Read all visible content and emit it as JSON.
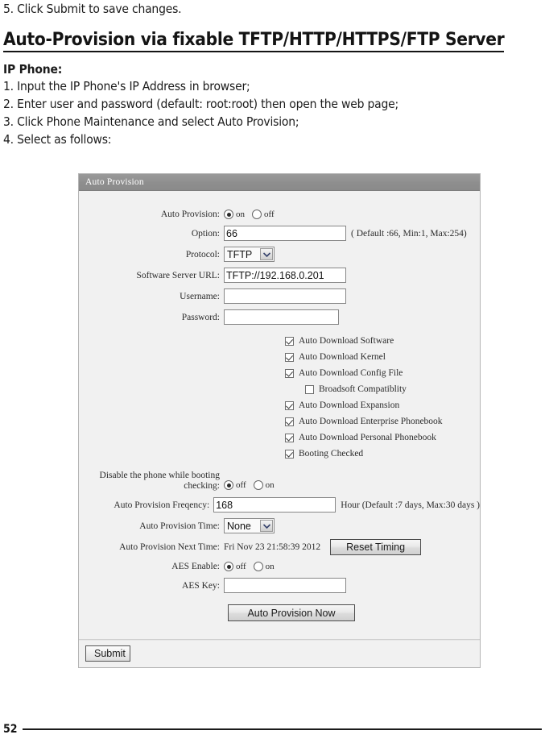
{
  "document": {
    "step_5": "5. Click Submit to save changes.",
    "section_title": "Auto-Provision via fixable TFTP/HTTP/HTTPS/FTP Server",
    "ip_phone_heading": "IP Phone:",
    "steps": [
      "1. Input the IP Phone's IP Address in browser;",
      "2. Enter user and password (default: root:root) then open the web page;",
      "3. Click Phone Maintenance and select Auto Provision;",
      "4. Select as follows:"
    ],
    "page_number": "52"
  },
  "panel": {
    "header_title": "Auto Provision",
    "fields": {
      "auto_provision": {
        "label": "Auto Provision:",
        "options": [
          "on",
          "off"
        ],
        "selected": "on"
      },
      "option": {
        "label": "Option:",
        "value": "66",
        "hint": "( Default :66, Min:1, Max:254)"
      },
      "protocol": {
        "label": "Protocol:",
        "value": "TFTP"
      },
      "software_server_url": {
        "label": "Software Server URL:",
        "value": "TFTP://192.168.0.201"
      },
      "username": {
        "label": "Username:",
        "value": ""
      },
      "password": {
        "label": "Password:",
        "value": ""
      },
      "disable_phone_booting": {
        "label_line1": "Disable the phone while booting",
        "label_line2": "checking:",
        "options": [
          "off",
          "on"
        ],
        "selected": "off"
      },
      "auto_provision_frequency": {
        "label": "Auto Provision Freqency:",
        "value": "168",
        "hint": "Hour (Default :7 days, Max:30 days )"
      },
      "auto_provision_time": {
        "label": "Auto Provision Time:",
        "value": "None"
      },
      "auto_provision_next_time": {
        "label": "Auto Provision Next Time:",
        "value": "Fri Nov 23 21:58:39 2012",
        "button": "Reset Timing"
      },
      "aes_enable": {
        "label": "AES Enable:",
        "options": [
          "off",
          "on"
        ],
        "selected": "off"
      },
      "aes_key": {
        "label": "AES Key:",
        "value": ""
      }
    },
    "checkboxes": [
      {
        "label": "Auto Download Software",
        "checked": true,
        "indent": false
      },
      {
        "label": "Auto Download Kernel",
        "checked": true,
        "indent": false
      },
      {
        "label": "Auto Download Config File",
        "checked": true,
        "indent": false
      },
      {
        "label": "Broadsoft Compatiblity",
        "checked": false,
        "indent": true
      },
      {
        "label": "Auto Download Expansion",
        "checked": true,
        "indent": false
      },
      {
        "label": "Auto Download Enterprise Phonebook",
        "checked": true,
        "indent": false
      },
      {
        "label": "Auto Download Personal Phonebook",
        "checked": true,
        "indent": false
      },
      {
        "label": "Booting Checked",
        "checked": true,
        "indent": false
      }
    ],
    "buttons": {
      "auto_provision_now": "Auto Provision Now",
      "submit": "Submit"
    }
  },
  "colors": {
    "header_bar": "#8e8e8e",
    "panel_bg": "#f1f1f1",
    "text": "#2b2b2b"
  }
}
